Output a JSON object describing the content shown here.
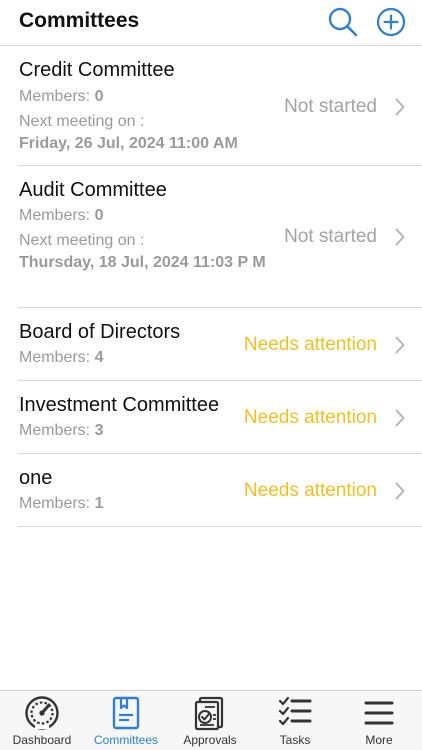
{
  "header": {
    "title": "Committees",
    "search_icon": "search-icon",
    "add_icon": "plus-circle-icon",
    "accent_color": "#2f7fd6"
  },
  "committees": [
    {
      "name": "Credit Committee",
      "members_label": "Members: ",
      "members_count": "0",
      "next_meeting_label": "Next meeting on :",
      "next_meeting_date": "Friday, 26 Jul, 2024 11:00 AM",
      "status": "Not started"
    },
    {
      "name": "Audit Committee",
      "members_label": "Members: ",
      "members_count": "0",
      "next_meeting_label": "Next meeting on :",
      "next_meeting_date": "Thursday, 18 Jul, 2024 11:03 P M",
      "status": "Not started"
    },
    {
      "name": "Board of Directors",
      "members_label": "Members: ",
      "members_count": "4",
      "status": "Needs attention"
    },
    {
      "name": "Investment Committee",
      "members_label": "Members: ",
      "members_count": "3",
      "status": "Needs attention"
    },
    {
      "name": "one",
      "members_label": "Members: ",
      "members_count": "1",
      "status": "Needs attention"
    }
  ],
  "status_colors": {
    "not_started": "#a3a3a3",
    "needs_attention": "#f2c01f"
  },
  "tabbar": {
    "tabs": [
      {
        "label": "Dashboard",
        "icon": "gauge-icon",
        "active": false
      },
      {
        "label": "Committees",
        "icon": "committee-folder-icon",
        "active": true
      },
      {
        "label": "Approvals",
        "icon": "approvals-document-icon",
        "active": false
      },
      {
        "label": "Tasks",
        "icon": "task-list-icon",
        "active": false
      },
      {
        "label": "More",
        "icon": "hamburger-menu-icon",
        "active": false
      }
    ]
  }
}
